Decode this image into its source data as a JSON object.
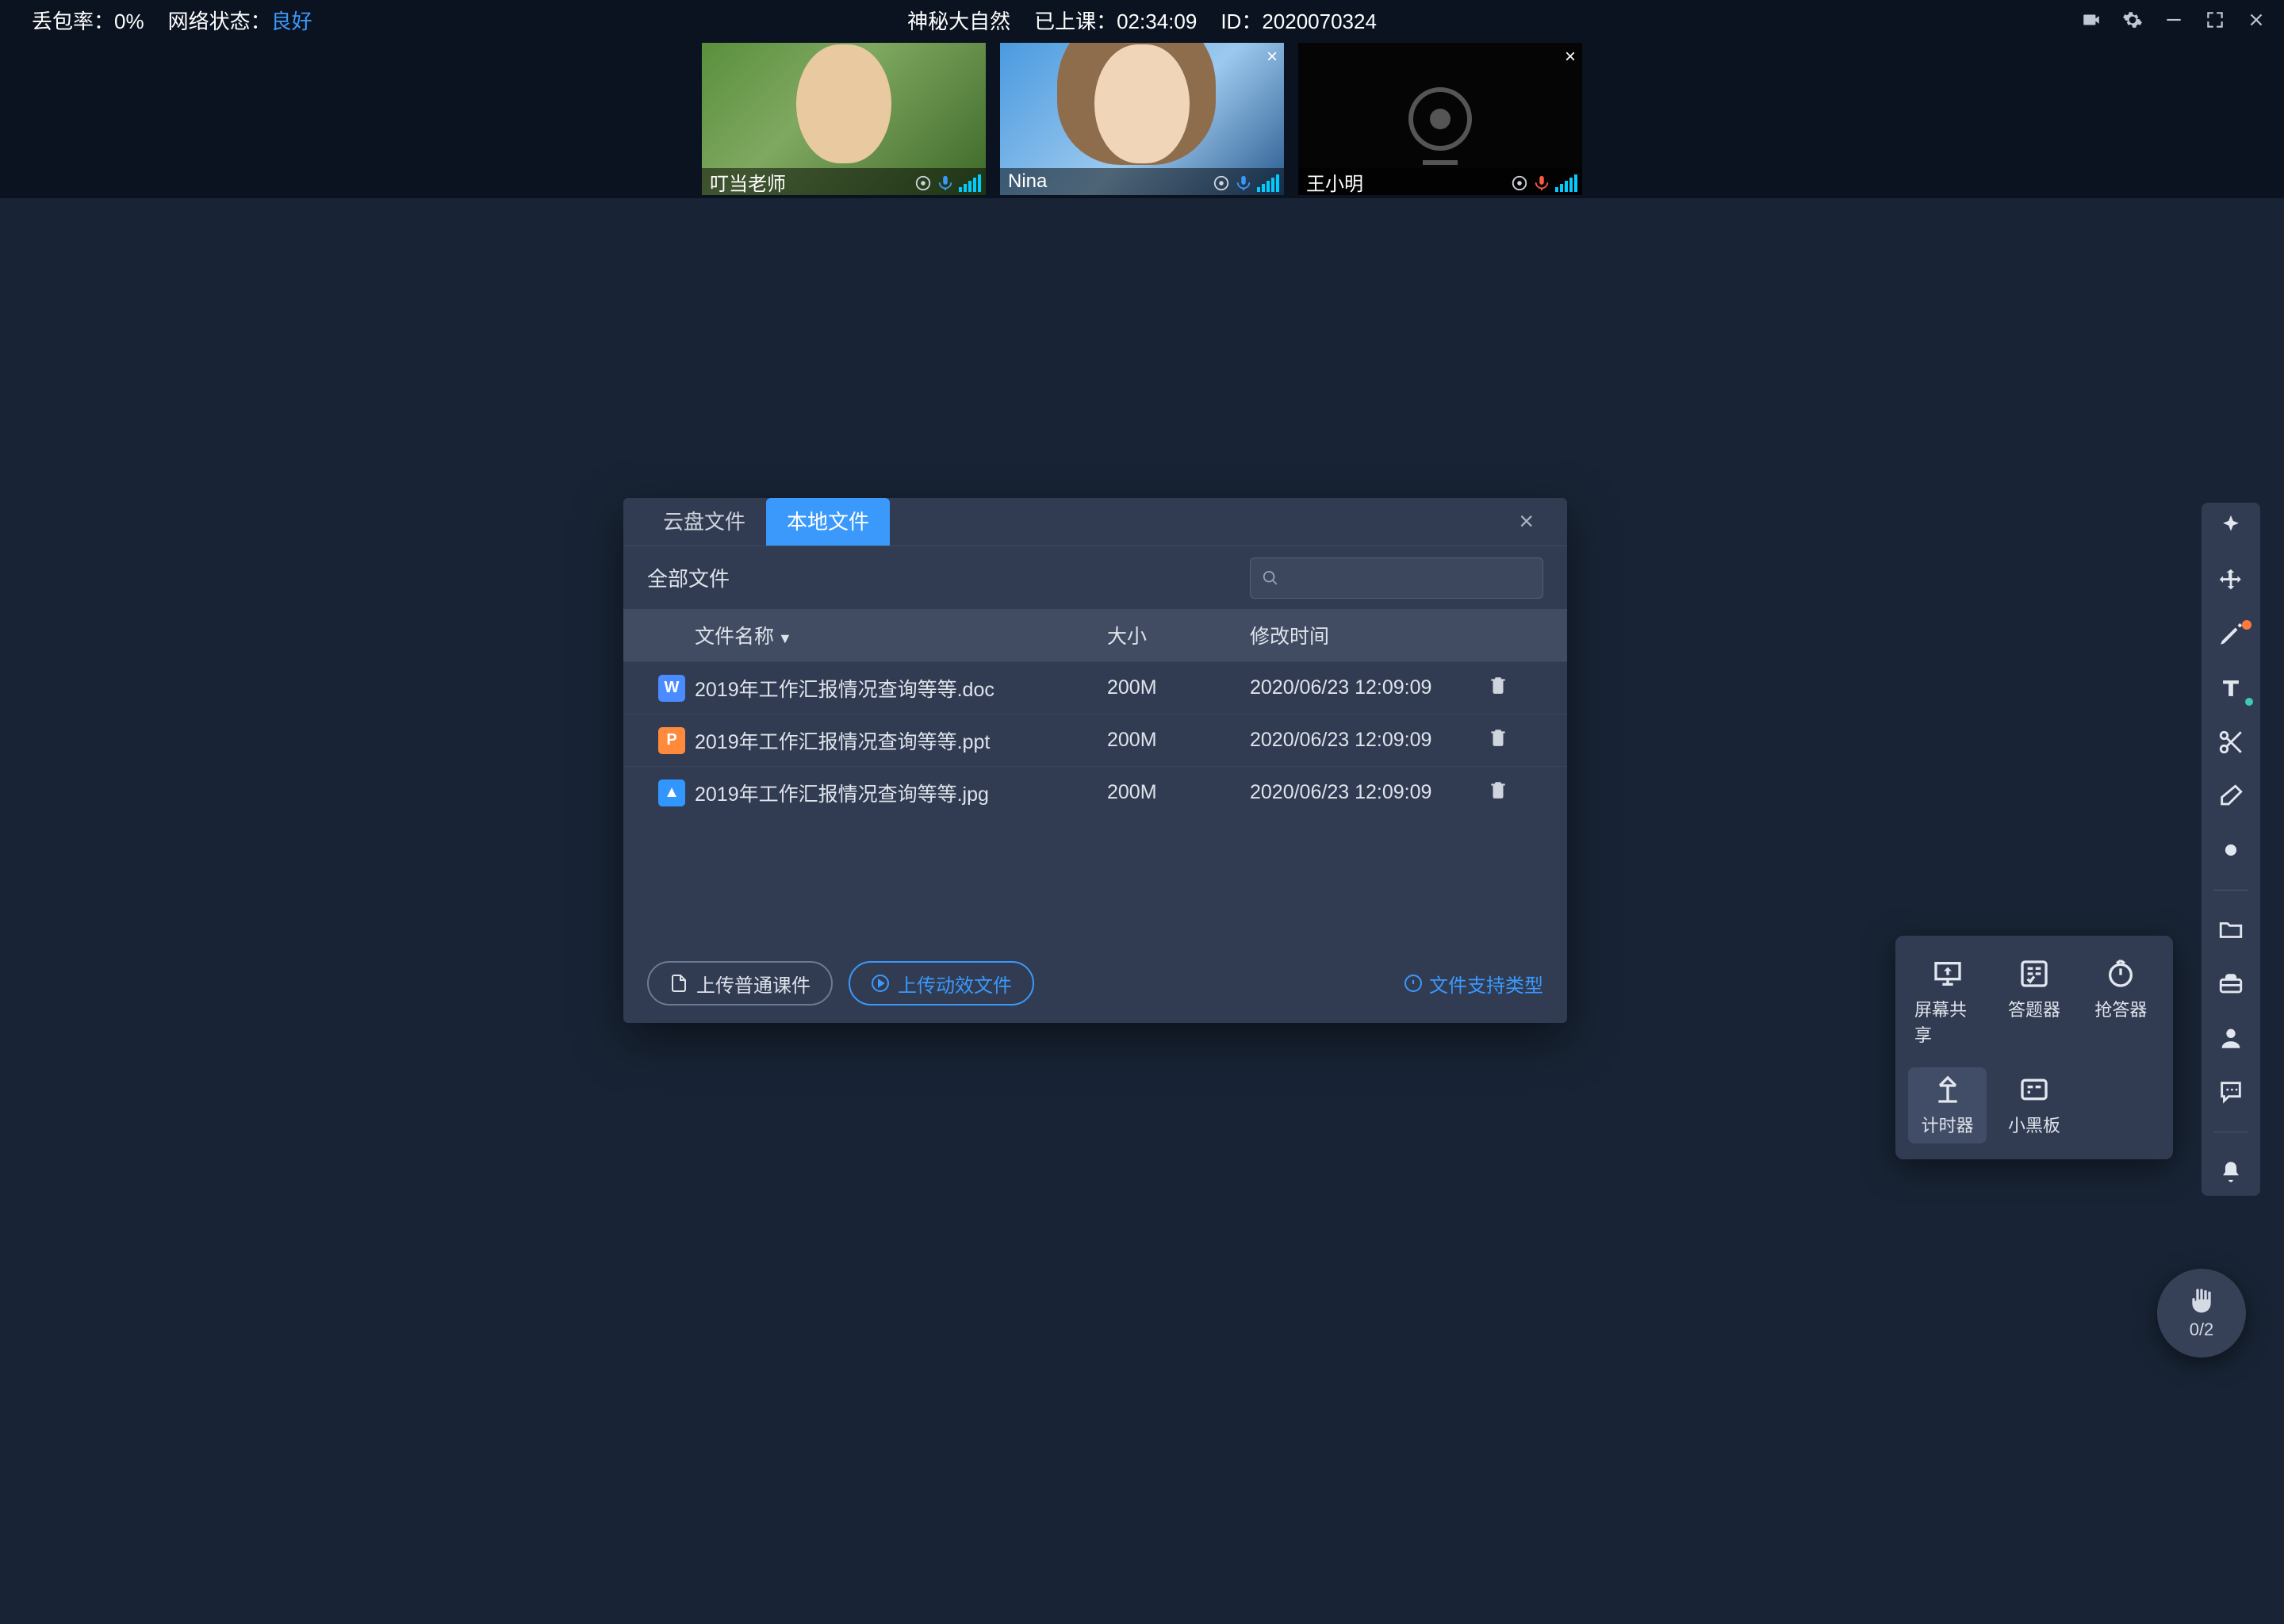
{
  "statusbar": {
    "loss_label": "丢包率：",
    "loss_value": "0%",
    "net_label": "网络状态：",
    "net_value": "良好",
    "title": "神秘大自然",
    "class_label": "已上课：",
    "class_time": "02:34:09",
    "id_label": "ID：",
    "id_value": "2020070324"
  },
  "participants": [
    {
      "name": "叮当老师",
      "kind": "teacher",
      "closable": false,
      "mic": "on",
      "cam": "on"
    },
    {
      "name": "Nina",
      "kind": "nina",
      "closable": true,
      "mic": "on",
      "cam": "on"
    },
    {
      "name": "王小明",
      "kind": "camoff",
      "closable": true,
      "mic": "on",
      "cam": "off",
      "mic_muted": true
    }
  ],
  "dialog": {
    "tabs": [
      "云盘文件",
      "本地文件"
    ],
    "active_tab": 1,
    "breadcrumb": "全部文件",
    "columns": {
      "name": "文件名称",
      "size": "大小",
      "mtime": "修改时间"
    },
    "files": [
      {
        "icon": "doc",
        "icon_text": "W",
        "name": "2019年工作汇报情况查询等等.doc",
        "size": "200M",
        "mtime": "2020/06/23 12:09:09"
      },
      {
        "icon": "ppt",
        "icon_text": "P",
        "name": "2019年工作汇报情况查询等等.ppt",
        "size": "200M",
        "mtime": "2020/06/23 12:09:09"
      },
      {
        "icon": "img",
        "icon_text": "▲",
        "name": "2019年工作汇报情况查询等等.jpg",
        "size": "200M",
        "mtime": "2020/06/23 12:09:09"
      }
    ],
    "upload_normal": "上传普通课件",
    "upload_anim": "上传动效文件",
    "supported": "文件支持类型"
  },
  "popover": {
    "items": [
      {
        "key": "screenshare",
        "label": "屏幕共享"
      },
      {
        "key": "answertool",
        "label": "答题器"
      },
      {
        "key": "buzzer",
        "label": "抢答器"
      },
      {
        "key": "timer",
        "label": "计时器",
        "active": true
      },
      {
        "key": "miniboard",
        "label": "小黑板"
      }
    ]
  },
  "rtoolbar": {
    "tools": [
      "laser",
      "move",
      "pen",
      "text",
      "scissors",
      "eraser",
      "color",
      "sep",
      "folder",
      "toolbox",
      "person",
      "chat",
      "sep",
      "bell"
    ]
  },
  "hand": {
    "count": "0/2"
  }
}
